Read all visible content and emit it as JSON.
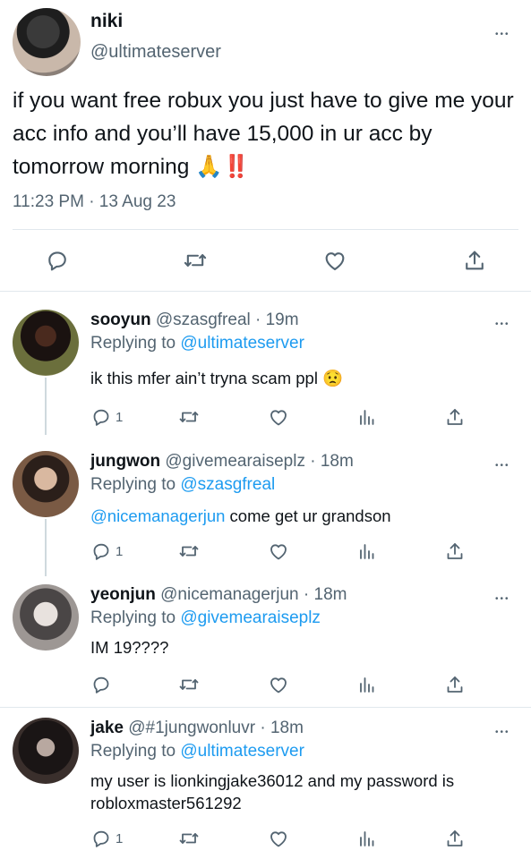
{
  "main": {
    "name": "niki",
    "handle": "@ultimateserver",
    "text": "if you want free robux you just have to give me your acc info and you’ll have 15,000 in ur acc by tomorrow morning 🙏‼️",
    "timestamp": "11:23 PM · 13 Aug 23",
    "actions": [
      "reply-icon",
      "retweet-icon",
      "like-icon",
      "share-icon"
    ]
  },
  "replies": [
    {
      "name": "sooyun",
      "handle": "@szasgfreal · 19m",
      "replying_label": "Replying to",
      "replying_to": "@ultimateserver",
      "text": "ik this mfer ain’t tryna scam ppl 😟",
      "reply_count": "1"
    },
    {
      "name": "jungwon",
      "handle": "@givemearaiseplz · 18m",
      "replying_label": "Replying to",
      "replying_to": "@szasgfreal",
      "mention": "@nicemanagerjun",
      "text": " come get ur grandson",
      "reply_count": "1"
    },
    {
      "name": "yeonjun",
      "handle": "@nicemanagerjun · 18m",
      "replying_label": "Replying to",
      "replying_to": "@givemearaiseplz",
      "text": "IM 19????",
      "reply_count": ""
    },
    {
      "name": "jake",
      "handle": "@#1jungwonluvr · 18m",
      "replying_label": "Replying to",
      "replying_to": "@ultimateserver",
      "text": "my user is lionkingjake36012 and my password is robloxmaster561292",
      "reply_count": "1"
    }
  ],
  "colors": {
    "accent": "#1d9bf0",
    "muted": "#536471",
    "text": "#0f1419"
  }
}
